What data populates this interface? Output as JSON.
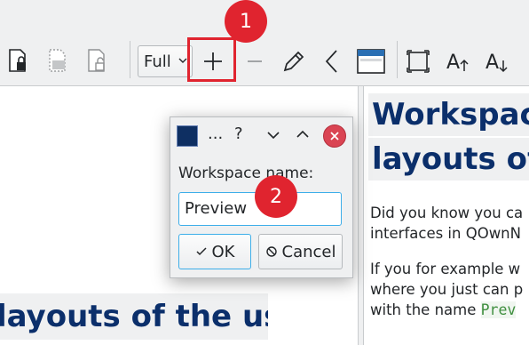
{
  "toolbar": {
    "zoom_select": "Full",
    "buttons": [
      "lock-document",
      "pattern-document",
      "unlock-document",
      "zoom-in",
      "zoom-out",
      "edit",
      "back",
      "window",
      "fullscreen",
      "increase-font",
      "decrease-font"
    ]
  },
  "callouts": [
    "1",
    "2"
  ],
  "left_heading": "layouts of the user",
  "right_pane": {
    "heading_line1": "Workspace",
    "heading_line2": "layouts of t",
    "para1_line1": "Did you know you ca",
    "para1_line2": "interfaces in QOwnN",
    "para2_line1": "If you for example w",
    "para2_line2": "where you just can p",
    "para2_line3_prefix": "with the name ",
    "para2_line3_code": "Prev"
  },
  "dialog": {
    "title_ellipsis": "...",
    "help": "?",
    "label": "Workspace name:",
    "input_value": "Preview",
    "ok": "OK",
    "cancel": "Cancel"
  },
  "colors": {
    "accent": "#3daee9",
    "callout": "#e0242f",
    "heading": "#0b2f6b",
    "close": "#da4453"
  }
}
